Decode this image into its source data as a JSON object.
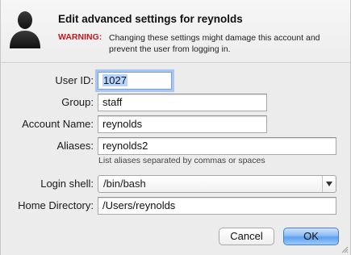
{
  "dialog": {
    "title": "Edit advanced settings for reynolds",
    "warning_label": "WARNING:",
    "warning_text": "Changing these settings might damage this account and prevent the user from logging in.",
    "icon": "user-silhouette-icon"
  },
  "form": {
    "user_id": {
      "label": "User ID:",
      "value": "1027"
    },
    "group": {
      "label": "Group:",
      "value": "staff"
    },
    "account_name": {
      "label": "Account Name:",
      "value": "reynolds"
    },
    "aliases": {
      "label": "Aliases:",
      "value": "reynolds2",
      "hint": "List aliases separated by commas or spaces"
    },
    "login_shell": {
      "label": "Login shell:",
      "value": "/bin/bash"
    },
    "home_directory": {
      "label": "Home Directory:",
      "value": "/Users/reynolds"
    }
  },
  "buttons": {
    "cancel": "Cancel",
    "ok": "OK"
  },
  "colors": {
    "warning": "#c4161c",
    "focus_ring": "#6f9fe0",
    "default_button": "#5d9ff0"
  }
}
